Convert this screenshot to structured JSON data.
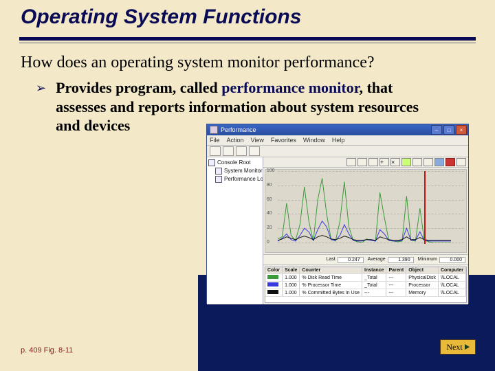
{
  "title": "Operating System Functions",
  "question": "How does an operating system monitor performance?",
  "bullet": {
    "pre": "Provides program, called ",
    "hl": "performance monitor",
    "post": ", that assesses and reports information about system resources and devices"
  },
  "footer_ref": "p. 409 Fig. 8-11",
  "next_label": "Next",
  "window": {
    "title": "Performance",
    "menu": [
      "File",
      "Action",
      "View",
      "Favorites",
      "Window",
      "Help"
    ],
    "tree": {
      "root": "Console Root",
      "items": [
        "System Monitor",
        "Performance Logs and Alerts"
      ]
    },
    "stats": {
      "last_label": "Last",
      "last": "0.247",
      "avg_label": "Average",
      "avg": "1.390",
      "min_label": "Minimum",
      "min": "0.000"
    },
    "legend": {
      "headers": [
        "Color",
        "Scale",
        "Counter",
        "Instance",
        "Parent",
        "Object",
        "Computer"
      ],
      "rows": [
        {
          "color": "#3a9b3a",
          "scale": "1.000",
          "counter": "% Disk Read Time",
          "instance": "_Total",
          "parent": "---",
          "object": "PhysicalDisk",
          "computer": "\\\\LOCAL"
        },
        {
          "color": "#3a3adc",
          "scale": "1.000",
          "counter": "% Processor Time",
          "instance": "_Total",
          "parent": "---",
          "object": "Processor",
          "computer": "\\\\LOCAL"
        },
        {
          "color": "#111",
          "scale": "1.000",
          "counter": "% Committed Bytes In Use",
          "instance": "---",
          "parent": "---",
          "object": "Memory",
          "computer": "\\\\LOCAL"
        }
      ]
    }
  },
  "chart_data": {
    "type": "line",
    "ylim": [
      0,
      100
    ],
    "yticks": [
      100,
      80,
      60,
      40,
      20,
      0
    ],
    "yticks_labels": [
      "100",
      "80",
      "60",
      "40",
      "20",
      "0"
    ],
    "x": [
      0,
      1,
      2,
      3,
      4,
      5,
      6,
      7,
      8,
      9,
      10,
      11,
      12,
      13,
      14,
      15,
      16,
      17,
      18,
      19,
      20,
      21,
      22,
      23,
      24,
      25,
      26,
      27,
      28,
      29,
      30,
      31,
      32,
      33,
      34,
      35,
      36,
      37,
      38,
      39
    ],
    "cursor_x": 33,
    "series": [
      {
        "name": "% Disk Read Time",
        "color": "#3a9b3a",
        "values": [
          5,
          8,
          55,
          10,
          3,
          25,
          78,
          30,
          2,
          60,
          90,
          40,
          5,
          2,
          30,
          85,
          22,
          3,
          1,
          0,
          5,
          3,
          2,
          70,
          35,
          3,
          2,
          1,
          2,
          65,
          3,
          2,
          48,
          3,
          1,
          0,
          0,
          0,
          0,
          0
        ]
      },
      {
        "name": "% Processor Time",
        "color": "#3a3adc",
        "values": [
          2,
          6,
          12,
          4,
          2,
          10,
          20,
          15,
          3,
          18,
          30,
          22,
          4,
          3,
          10,
          25,
          12,
          3,
          2,
          2,
          4,
          3,
          2,
          18,
          12,
          3,
          2,
          2,
          3,
          20,
          3,
          3,
          15,
          3,
          2,
          2,
          2,
          2,
          2,
          2
        ]
      },
      {
        "name": "% Committed Bytes In Use",
        "color": "#111",
        "values": [
          3,
          5,
          8,
          6,
          4,
          7,
          9,
          7,
          4,
          8,
          10,
          8,
          5,
          4,
          6,
          9,
          7,
          4,
          3,
          3,
          4,
          4,
          3,
          8,
          6,
          4,
          3,
          3,
          4,
          8,
          4,
          4,
          7,
          4,
          3,
          3,
          3,
          3,
          3,
          3
        ]
      }
    ]
  }
}
